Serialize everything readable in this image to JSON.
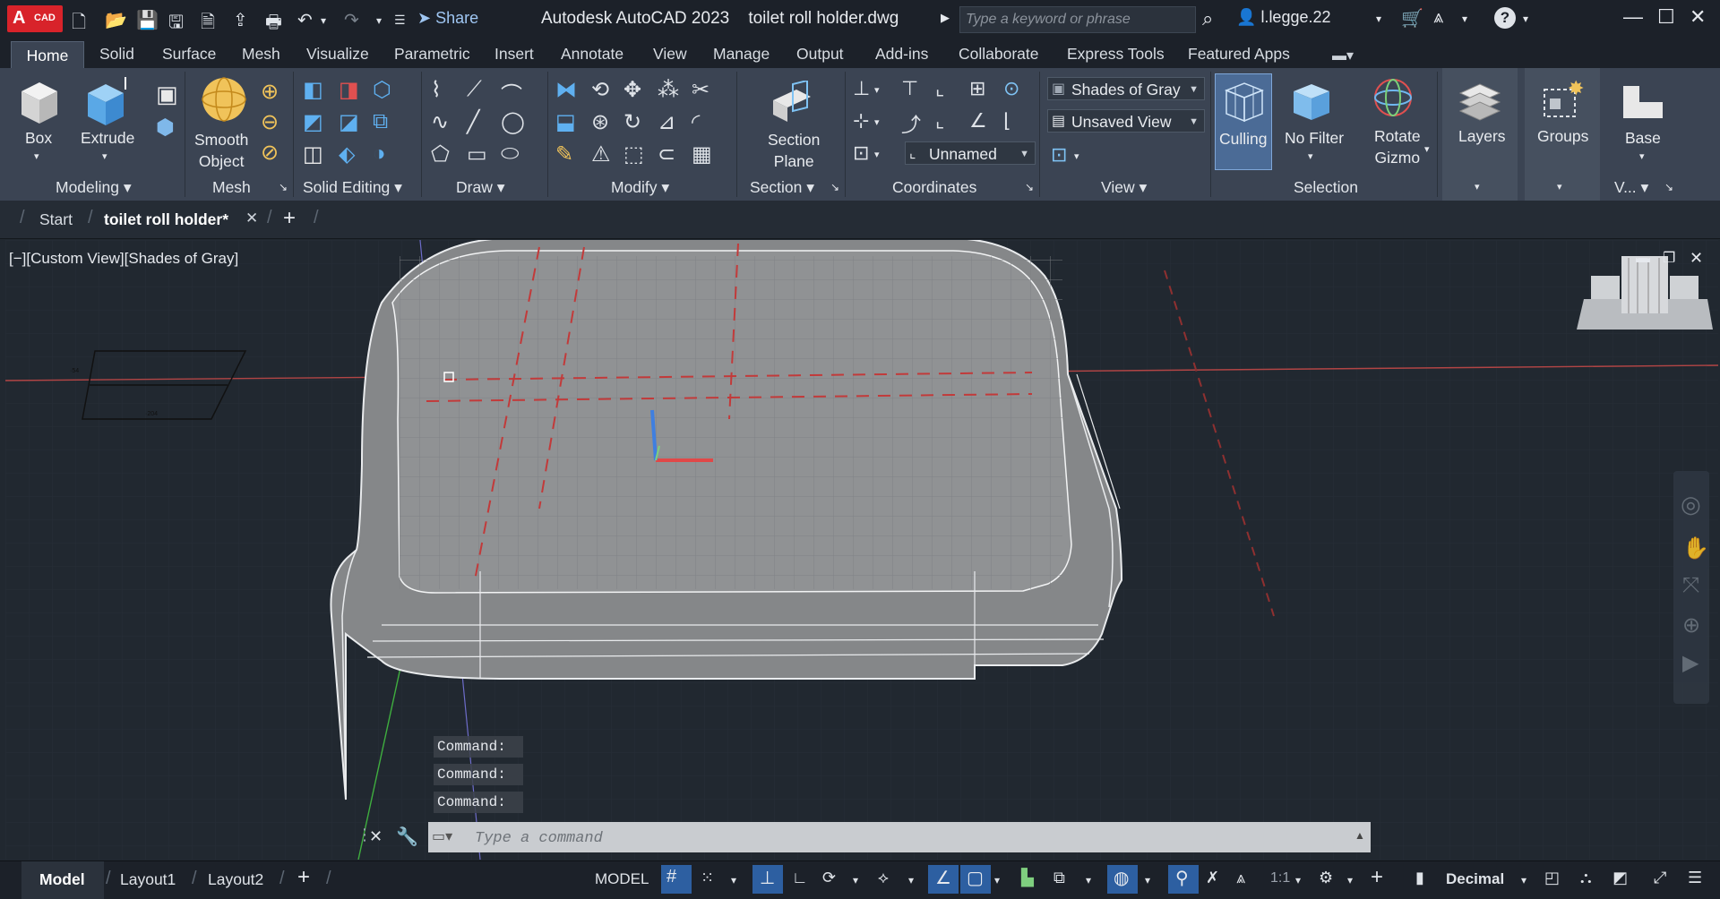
{
  "title_bar": {
    "logo_letter": "A",
    "logo_text": "CAD",
    "share_label": "Share",
    "app_title": "Autodesk AutoCAD 2023",
    "file_title": "toilet roll holder.dwg",
    "search_placeholder": "Type a keyword or phrase",
    "user_name": "l.legge.22"
  },
  "ribbon_tabs": [
    "Home",
    "Solid",
    "Surface",
    "Mesh",
    "Visualize",
    "Parametric",
    "Insert",
    "Annotate",
    "View",
    "Manage",
    "Output",
    "Add-ins",
    "Collaborate",
    "Express Tools",
    "Featured Apps"
  ],
  "ribbon": {
    "modeling": {
      "title": "Modeling",
      "box": "Box",
      "extrude": "Extrude"
    },
    "mesh": {
      "title": "Mesh",
      "smooth_line1": "Smooth",
      "smooth_line2": "Object"
    },
    "solid_editing": {
      "title": "Solid Editing"
    },
    "draw": {
      "title": "Draw"
    },
    "modify": {
      "title": "Modify"
    },
    "section": {
      "title": "Section",
      "plane_line1": "Section",
      "plane_line2": "Plane"
    },
    "coordinates": {
      "title": "Coordinates",
      "ucs_name": "Unnamed"
    },
    "view": {
      "title": "View",
      "visual_style": "Shades of Gray",
      "named_view": "Unsaved View"
    },
    "selection": {
      "title": "Selection",
      "culling": "Culling",
      "no_filter": "No Filter",
      "rotate_line1": "Rotate",
      "rotate_line2": "Gizmo"
    },
    "layers": {
      "label": "Layers"
    },
    "groups": {
      "label": "Groups"
    },
    "base": {
      "label": "Base",
      "panel_title": "V..."
    }
  },
  "file_tabs": {
    "start": "Start",
    "active": "toilet roll holder*"
  },
  "viewport": {
    "label": "[−][Custom View][Shades of Gray]",
    "cmd_history": [
      "Command:",
      "Command:",
      "Command:"
    ],
    "cmd_placeholder": "Type a command"
  },
  "layout_tabs": [
    "Model",
    "Layout1",
    "Layout2"
  ],
  "status_bar": {
    "model": "MODEL",
    "scale": "1:1",
    "units": "Decimal"
  },
  "colors": {
    "ribbon_bg": "#3b4453",
    "titlebar_bg": "#1c2129",
    "viewport_bg": "#212830",
    "accent_blue": "#2d5fa1",
    "solid_gray": "#8a8c8f"
  }
}
